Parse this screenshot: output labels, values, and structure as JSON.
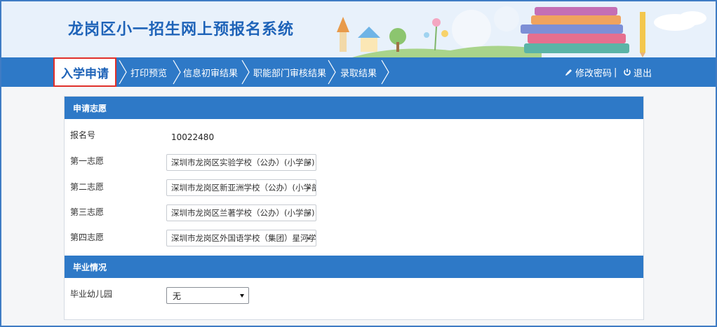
{
  "header": {
    "title": "龙岗区小一招生网上预报名系统"
  },
  "nav": {
    "items": [
      "入学申请",
      "打印预览",
      "信息初审结果",
      "职能部门审核结果",
      "录取结果"
    ],
    "change_password": "修改密码",
    "separator": "|",
    "logout": "退出"
  },
  "sections": {
    "choices_title": "申请志愿",
    "graduation_title": "毕业情况"
  },
  "form": {
    "reg_no_label": "报名号",
    "reg_no_value": "10022480",
    "choice1_label": "第一志愿",
    "choice1_value": "深圳市龙岗区实验学校（公办）(小学部)",
    "choice2_label": "第二志愿",
    "choice2_value": "深圳市龙岗区新亚洲学校（公办）(小学部)",
    "choice3_label": "第三志愿",
    "choice3_value": "深圳市龙岗区兰著学校（公办）(小学部)",
    "choice4_label": "第四志愿",
    "choice4_value": "深圳市龙岗区外国语学校（集团）星河学...",
    "kindergarten_label": "毕业幼儿园",
    "kindergarten_value": "无"
  },
  "colors": {
    "primary": "#2e79c7",
    "title": "#1e63b8",
    "active_border": "#e0302a"
  }
}
